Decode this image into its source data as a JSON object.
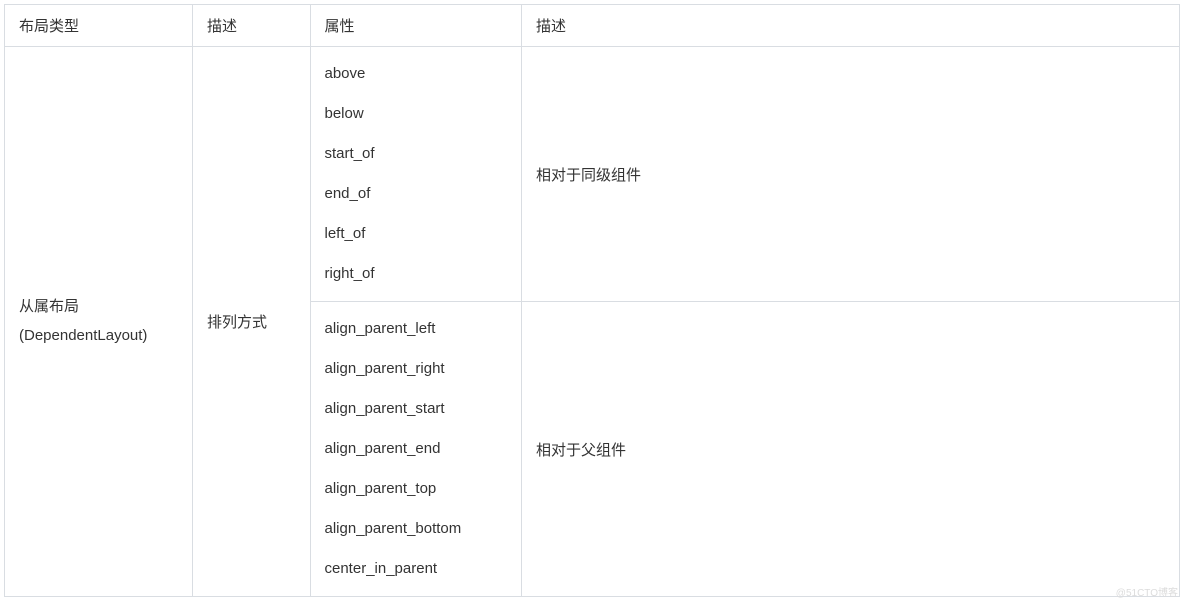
{
  "headers": {
    "col0": "布局类型",
    "col1": "描述",
    "col2": "属性",
    "col3": "描述"
  },
  "layout": {
    "type_line1": "从属布局",
    "type_line2": "(DependentLayout)",
    "arrangement": "排列方式"
  },
  "groups": [
    {
      "attrs": [
        "above",
        "below",
        "start_of",
        "end_of",
        "left_of",
        "right_of"
      ],
      "desc": "相对于同级组件"
    },
    {
      "attrs": [
        "align_parent_left",
        "align_parent_right",
        "align_parent_start",
        "align_parent_end",
        "align_parent_top",
        "align_parent_bottom",
        "center_in_parent"
      ],
      "desc": "相对于父组件"
    }
  ],
  "watermark": "@51CTO博客"
}
